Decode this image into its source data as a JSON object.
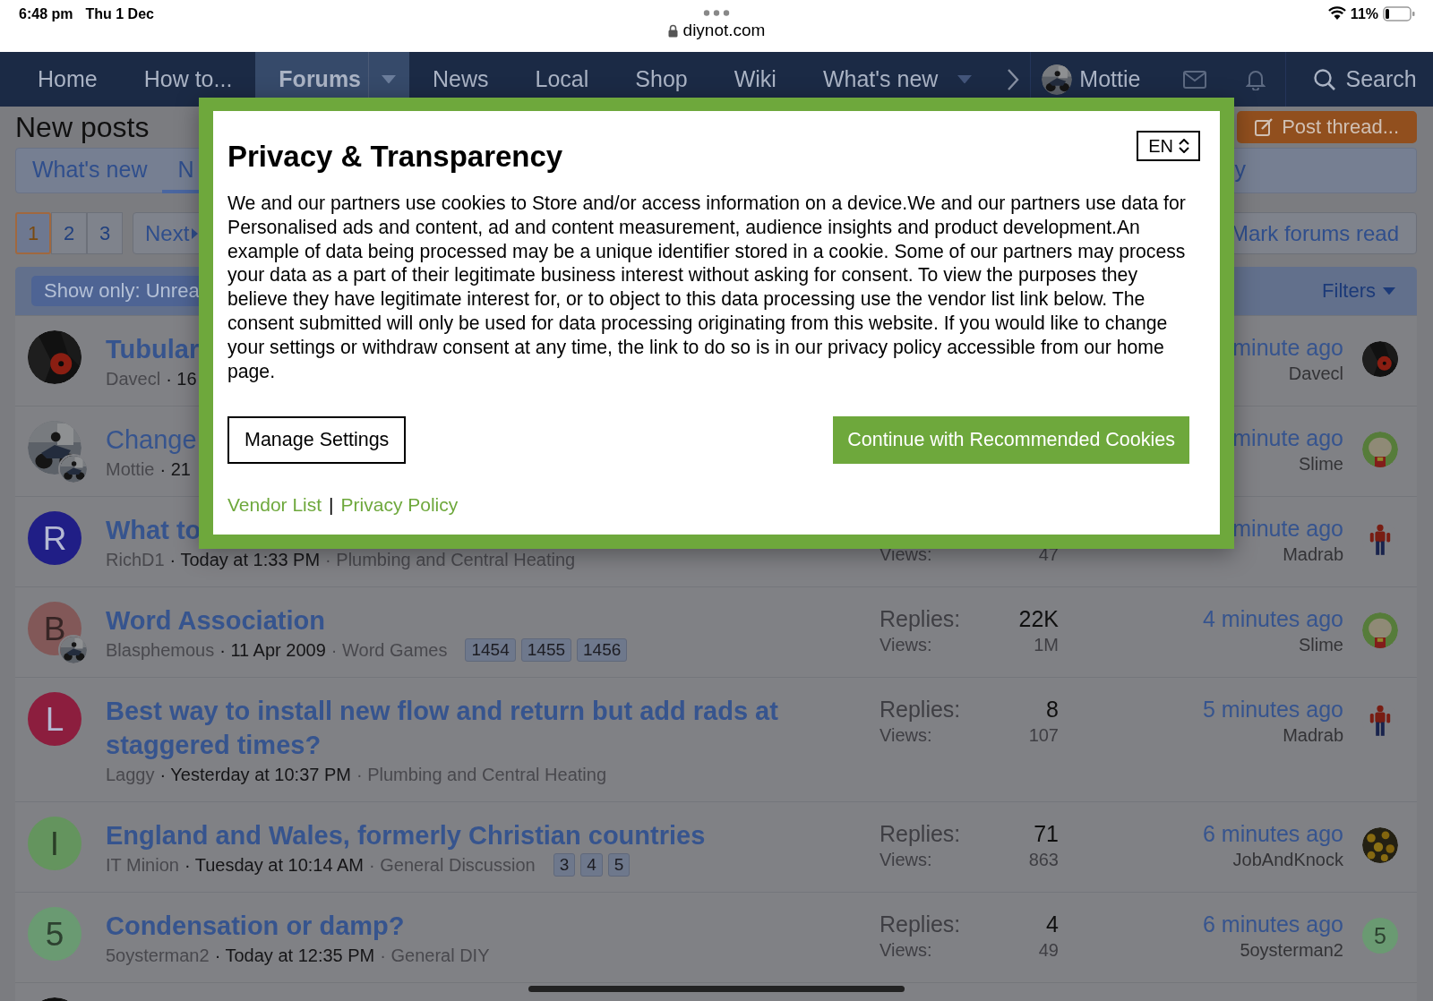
{
  "status_bar": {
    "time": "6:48 pm",
    "date": "Thu 1 Dec",
    "url": "diynot.com",
    "battery": "11%"
  },
  "nav": {
    "items": [
      {
        "label": "Home",
        "selected": false,
        "dropdown": false
      },
      {
        "label": "How to...",
        "selected": false,
        "dropdown": false
      },
      {
        "label": "Forums",
        "selected": true,
        "dropdown": true
      },
      {
        "label": "News",
        "selected": false,
        "dropdown": false
      },
      {
        "label": "Local",
        "selected": false,
        "dropdown": false
      },
      {
        "label": "Shop",
        "selected": false,
        "dropdown": false
      },
      {
        "label": "Wiki",
        "selected": false,
        "dropdown": false
      },
      {
        "label": "What's new",
        "selected": false,
        "dropdown": true
      }
    ],
    "user": "Mottie",
    "search": "Search"
  },
  "page": {
    "title": "New posts",
    "post_button": "Post thread...",
    "tabs": [
      {
        "label": "What's new",
        "selected": false
      },
      {
        "label": "N",
        "selected": true
      },
      {
        "label": "y",
        "selected": false
      }
    ],
    "pages": [
      {
        "label": "1",
        "selected": true
      },
      {
        "label": "2",
        "selected": false
      },
      {
        "label": "3",
        "selected": false
      }
    ],
    "next": "Next",
    "mark_read": "Mark forums read",
    "show_only": "Show only: Unrea",
    "filters": "Filters",
    "threads": [
      {
        "avatar": {
          "kind": "picture"
        },
        "title": "Tubular",
        "unread": true,
        "author": "Davecl",
        "date": "· 16",
        "last_time": "minute ago",
        "last_user": "Davecl",
        "last_avatar": {
          "kind": "picture"
        }
      },
      {
        "avatar": {
          "kind": "picture"
        },
        "sub_avatar": {
          "kind": "picture"
        },
        "title": "Change",
        "unread": false,
        "author": "Mottie",
        "date": "· 21",
        "last_time": "minute ago",
        "last_user": "Slime",
        "last_avatar": {
          "kind": "picture"
        }
      },
      {
        "avatar": {
          "kind": "letter",
          "letter": "R",
          "color": "#201e86"
        },
        "title": "What to",
        "unread": true,
        "author": "RichD1",
        "date": "· Today at 1:33 PM",
        "forum": "· Plumbing and Central Heating",
        "views_label": "Views:",
        "views": "47",
        "last_time": "minute ago",
        "last_user": "Madrab",
        "last_avatar": {
          "kind": "picture"
        }
      },
      {
        "avatar": {
          "kind": "letter",
          "letter": "B",
          "color": "#825858"
        },
        "sub_avatar": {
          "kind": "picture"
        },
        "title": "Word Association",
        "unread": true,
        "author": "Blasphemous",
        "date": "· 11 Apr 2009",
        "forum": "· Word Games",
        "pages": [
          "1454",
          "1455",
          "1456"
        ],
        "replies_label": "Replies:",
        "replies": "22K",
        "views_label": "Views:",
        "views": "1M",
        "last_time": "4 minutes ago",
        "last_user": "Slime",
        "last_avatar": {
          "kind": "picture"
        }
      },
      {
        "avatar": {
          "kind": "letter",
          "letter": "L",
          "color": "#8c1e3e"
        },
        "title": "Best way to install new flow and return but add rads at staggered times?",
        "unread": true,
        "author": "Laggy",
        "date": "· Yesterday at 10:37 PM",
        "forum": "· Plumbing and Central Heating",
        "replies_label": "Replies:",
        "replies": "8",
        "views_label": "Views:",
        "views": "107",
        "last_time": "5 minutes ago",
        "last_user": "Madrab",
        "last_avatar": {
          "kind": "picture"
        }
      },
      {
        "avatar": {
          "kind": "letter",
          "letter": "I",
          "color": "#64945e"
        },
        "title": "England and Wales, formerly Christian countries",
        "unread": true,
        "author": "IT Minion",
        "date": "· Tuesday at 10:14 AM",
        "forum": "· General Discussion",
        "pages": [
          "3",
          "4",
          "5"
        ],
        "replies_label": "Replies:",
        "replies": "71",
        "views_label": "Views:",
        "views": "863",
        "last_time": "6 minutes ago",
        "last_user": "JobAndKnock",
        "last_avatar": {
          "kind": "picture"
        }
      },
      {
        "avatar": {
          "kind": "letter",
          "letter": "5",
          "color": "#6a9a72"
        },
        "title": "Condensation or damp?",
        "unread": true,
        "author": "5oysterman2",
        "date": "· Today at 12:35 PM",
        "forum": "· General DIY",
        "replies_label": "Replies:",
        "replies": "4",
        "views_label": "Views:",
        "views": "49",
        "last_time": "6 minutes ago",
        "last_user": "5oysterman2",
        "last_avatar": {
          "kind": "letter",
          "letter": "5",
          "color": "#6a9a72"
        }
      },
      {
        "avatar": {
          "kind": "picture"
        }
      }
    ]
  },
  "consent": {
    "title": "Privacy & Transparency",
    "language": "EN",
    "text": "We and our partners use cookies to Store and/or access information on a device.We and our partners use data for Personalised ads and content, ad and content measurement, audience insights and product development.An example of data being processed may be a unique identifier stored in a cookie. Some of our partners may process your data as a part of their legitimate business interest without asking for consent. To view the purposes they believe they have legitimate interest for, or to object to this data processing use the vendor list link below. The consent submitted will only be used for data processing originating from this website. If you would like to change your settings or withdraw consent at any time, the link to do so is in our privacy policy accessible from our home page.",
    "manage": "Manage Settings",
    "accept": "Continue with Recommended Cookies",
    "links": [
      "Vendor List",
      "Privacy Policy"
    ],
    "separator": "|"
  }
}
